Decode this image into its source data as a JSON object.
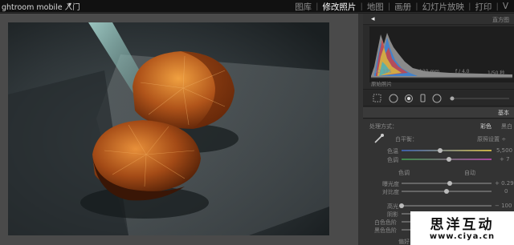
{
  "app": {
    "title": "ghtroom mobile 入门",
    "caret": "▾"
  },
  "modules": [
    "图库",
    "修改照片",
    "地图",
    "画册",
    "幻灯片放映",
    "打印",
    "V"
  ],
  "active_module_index": 1,
  "panel": {
    "histogram_title": "直方图",
    "hist_info": [
      "ISO 125",
      "120 mm",
      "f / 4.0",
      "1/50 秒"
    ],
    "original_photo": "原始照片",
    "basic_title": "基本",
    "treatment_label": "处理方式：",
    "treatment_color": "彩色",
    "treatment_bw": "黑白",
    "wb_label": "白平衡：",
    "wb_value": "原照设置 ÷",
    "temp_label": "色温",
    "temp_value": "5,500",
    "tint_label": "色调",
    "tint_value": "+ 7",
    "tone_label": "色调",
    "auto_label": "自动",
    "exposure_label": "曝光度",
    "exposure_value": "+ 0.29",
    "contrast_label": "对比度",
    "contrast_value": "0",
    "highlights_label": "高光",
    "highlights_value": "− 100",
    "shadows_label": "阴影",
    "whites_label": "白色色阶",
    "blacks_label": "黑色色阶",
    "presence_label": "偏好"
  },
  "watermark": {
    "name": "思洋互动",
    "url": "www.ciya.cn"
  }
}
